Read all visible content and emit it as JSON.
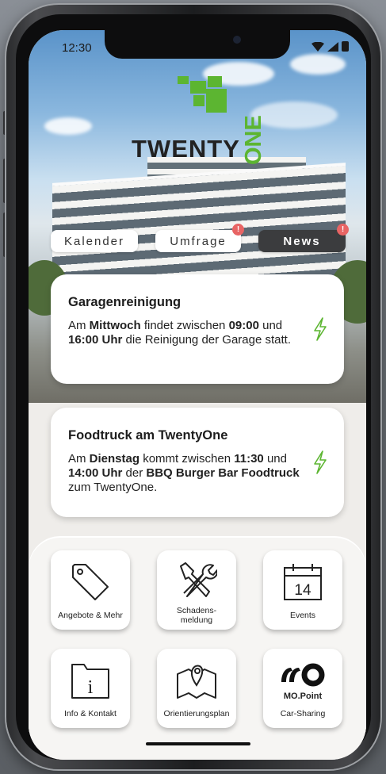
{
  "status": {
    "time": "12:30"
  },
  "brand": {
    "name_left": "TWENTY",
    "name_right": "ONE"
  },
  "tabs": [
    {
      "label": "Kalender",
      "badge": ""
    },
    {
      "label": "Umfrage",
      "badge": "!"
    },
    {
      "label": "News",
      "badge": "!"
    }
  ],
  "news": [
    {
      "title": "Garagenreinigung",
      "p1": "Am ",
      "b1": "Mittwoch",
      "p2": " findet zwischen ",
      "b2": "09:00",
      "p3": " und ",
      "b3": "16:00 Uhr",
      "p4": " die Reinigung der Garage statt."
    },
    {
      "title": "Foodtruck am TwentyOne",
      "p1": "Am ",
      "b1": "Dienstag",
      "p2": " kommt zwischen ",
      "b2": "11:30",
      "p3": " und ",
      "b3": "14:00 Uhr",
      "p4": " der ",
      "b4": "BBQ Burger Bar Foodtruck",
      "p5": " zum TwentyOne."
    }
  ],
  "tiles": [
    {
      "label": "Angebote & Mehr",
      "icon": "tag-icon"
    },
    {
      "label": "Schadens-",
      "label2": "meldung",
      "icon": "tools-icon"
    },
    {
      "label": "Events",
      "icon": "calendar-icon",
      "day": "14"
    },
    {
      "label": "Info & Kontakt",
      "icon": "info-folder-icon",
      "glyph": "i"
    },
    {
      "label": "Orientierungsplan",
      "icon": "map-icon"
    },
    {
      "label": "Car-Sharing",
      "brand": "MO.Point",
      "icon": "mopoint-logo"
    }
  ],
  "colors": {
    "accent_green": "#5cb531",
    "badge_red": "#e86464",
    "active_tab": "#3b3c3e"
  }
}
